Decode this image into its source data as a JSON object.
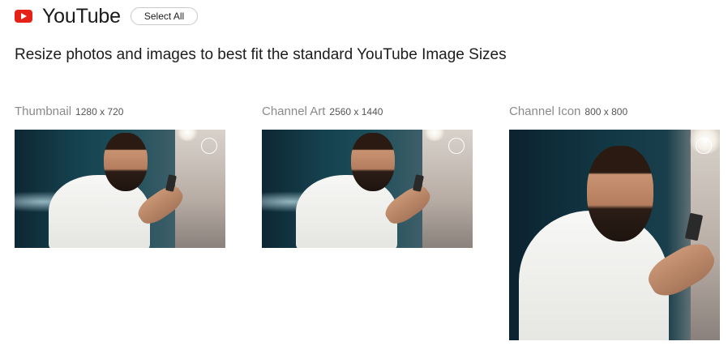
{
  "header": {
    "brand": "YouTube",
    "logo_icon": "youtube-logo-icon",
    "logo_color": "#e62117",
    "select_all_label": "Select All"
  },
  "subtitle": "Resize photos and images to best fit the standard YouTube Image Sizes",
  "cards": [
    {
      "name": "Thumbnail",
      "dimensions": "1280 x 720"
    },
    {
      "name": "Channel Art",
      "dimensions": "2560 x 1440"
    },
    {
      "name": "Channel Icon",
      "dimensions": "800 x 800"
    }
  ]
}
